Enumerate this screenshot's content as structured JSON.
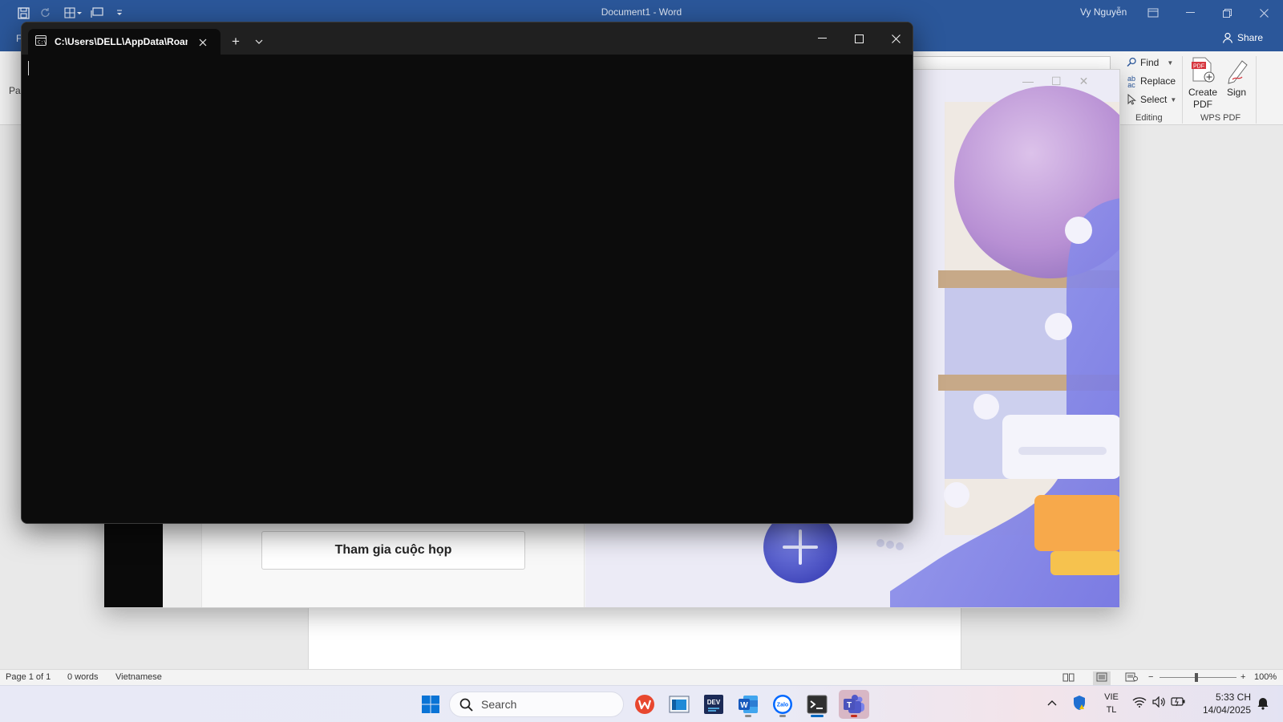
{
  "word": {
    "title": "Document1  -  Word",
    "user": "Vy Nguyễn",
    "file_tab": "F",
    "share_label": "Share",
    "paste_label": "Pa",
    "editing": {
      "find": "Find",
      "replace": "Replace",
      "select": "Select",
      "group_label": "Editing"
    },
    "wps_pdf": {
      "create_line1": "Create",
      "create_line2": "PDF",
      "sign": "Sign",
      "group_label": "WPS PDF"
    },
    "status": {
      "page": "Page 1 of 1",
      "words": "0 words",
      "language": "Vietnamese",
      "zoom": "100%",
      "zoom_minus": "−",
      "zoom_plus": "+"
    }
  },
  "teams": {
    "join_button": "Tham gia cuộc họp"
  },
  "terminal": {
    "tab_title": "C:\\Users\\DELL\\AppData\\Roam",
    "new_tab": "+",
    "colors": {
      "background": "#0c0c0c",
      "titlebar": "#202020"
    }
  },
  "taskbar": {
    "search_placeholder": "Search",
    "apps": [
      "start-icon",
      "wps-office-icon",
      "file-explorer-icon",
      "dev-tool-icon",
      "word-icon",
      "zalo-icon",
      "terminal-icon",
      "teams-icon"
    ],
    "dev_label": "DEV",
    "word_label": "W",
    "zalo_label": "Zalo",
    "teams_label": "T",
    "language_line1": "VIE",
    "language_line2": "TL",
    "time": "5:33 CH",
    "date": "14/04/2025"
  }
}
